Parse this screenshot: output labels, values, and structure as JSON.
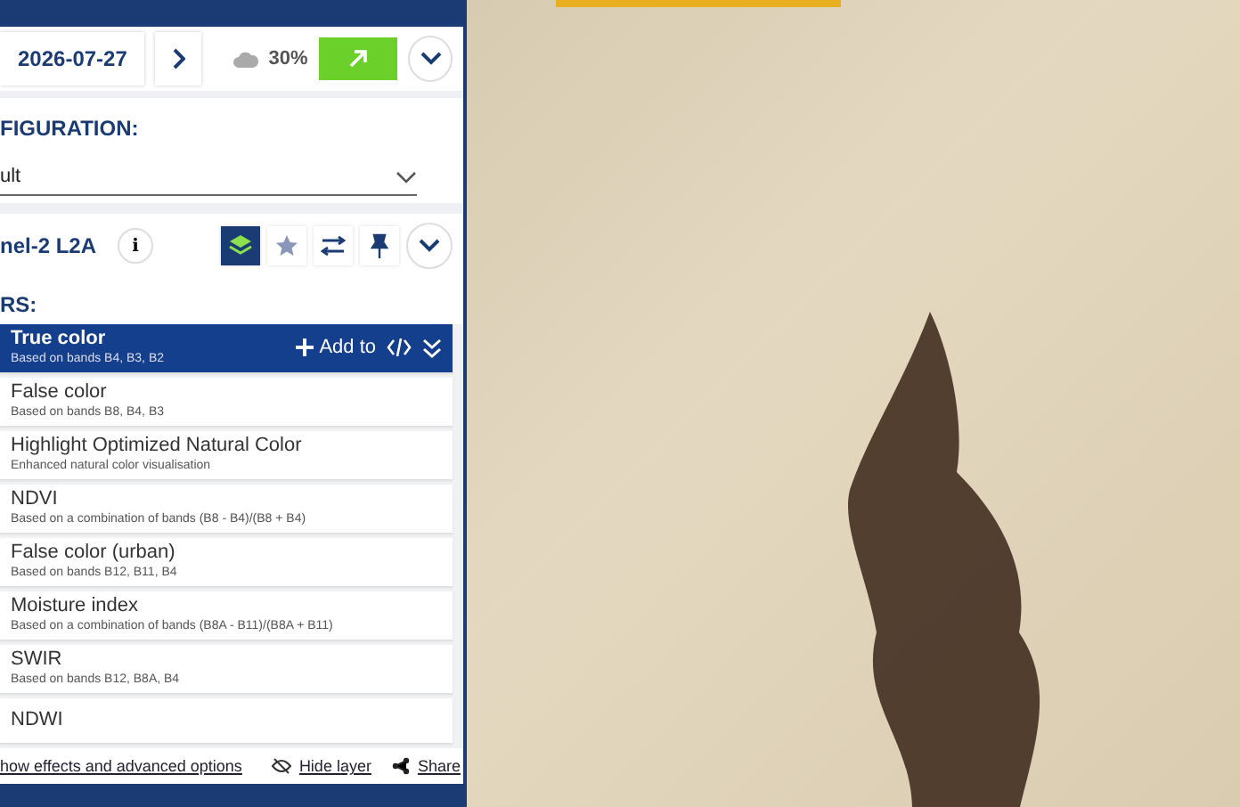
{
  "date_bar": {
    "date": "2026-07-27",
    "cloud_cover": "30%"
  },
  "configuration": {
    "heading": "FIGURATION:",
    "value": "ult"
  },
  "datasource": {
    "name": "nel-2 L2A",
    "info": "i"
  },
  "layers": {
    "heading": "RS:",
    "add_to": "Add to",
    "items": [
      {
        "title": "True color",
        "description": "Based on bands B4, B3, B2",
        "selected": true
      },
      {
        "title": "False color",
        "description": "Based on bands B8, B4, B3",
        "selected": false
      },
      {
        "title": "Highlight Optimized Natural Color",
        "description": "Enhanced natural color visualisation",
        "selected": false
      },
      {
        "title": "NDVI",
        "description": "Based on a combination of bands (B8 - B4)/(B8 + B4)",
        "selected": false
      },
      {
        "title": "False color (urban)",
        "description": "Based on bands B12, B11, B4",
        "selected": false
      },
      {
        "title": "Moisture index",
        "description": "Based on a combination of bands (B8A - B11)/(B8A + B11)",
        "selected": false
      },
      {
        "title": "SWIR",
        "description": "Based on bands B12, B8A, B4",
        "selected": false
      },
      {
        "title": "NDWI",
        "selected": false
      }
    ]
  },
  "footer": {
    "advanced": "how effects and advanced options",
    "hide_layer": "Hide layer",
    "share": "Share"
  }
}
